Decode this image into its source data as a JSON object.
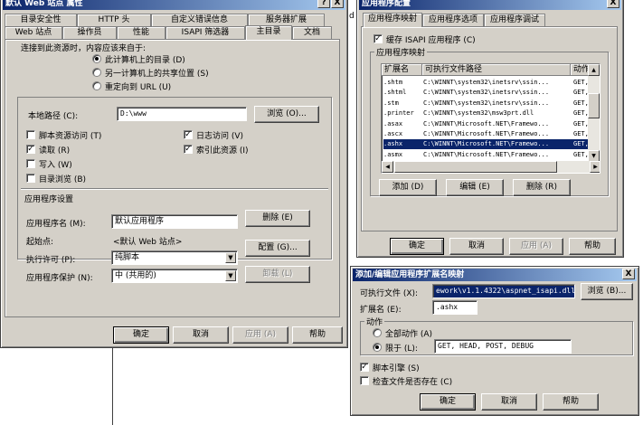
{
  "win1": {
    "title": "默认 Web 站点 属性",
    "help_btn": "?",
    "close_btn": "X",
    "tabs_row1": [
      "目录安全性",
      "HTTP 头",
      "自定义错误信息",
      "服务器扩展"
    ],
    "tabs_row2": [
      "Web 站点",
      "操作员",
      "性能",
      "ISAPI 筛选器",
      "主目录",
      "文档"
    ],
    "connect_label": "连接到此资源时，内容应该来自于:",
    "radio_options": [
      "此计算机上的目录 (D)",
      "另一计算机上的共享位置 (S)",
      "重定向到 URL (U)"
    ],
    "local_path_label": "本地路径 (C):",
    "local_path_value": "D:\\www",
    "browse_button": "浏览 (O)...",
    "checks_left": [
      {
        "label": "脚本资源访问 (T)",
        "checked": false
      },
      {
        "label": "读取 (R)",
        "checked": true
      },
      {
        "label": "写入 (W)",
        "checked": false
      },
      {
        "label": "目录浏览 (B)",
        "checked": false
      }
    ],
    "checks_right": [
      {
        "label": "日志访问 (V)",
        "checked": true
      },
      {
        "label": "索引此资源 (I)",
        "checked": true
      }
    ],
    "app_settings_label": "应用程序设置",
    "app_name_label": "应用程序名 (M):",
    "app_name_value": "默认应用程序",
    "remove_button": "删除 (E)",
    "start_point_label": "起始点:",
    "start_point_value": "<默认 Web 站点>",
    "config_button": "配置 (G)...",
    "exec_perm_label": "执行许可 (P):",
    "exec_perm_value": "纯脚本",
    "app_protect_label": "应用程序保护 (N):",
    "app_protect_value": "中 (共用的)",
    "unload_button": "卸载 (L)",
    "ok": "确定",
    "cancel": "取消",
    "apply": "应用 (A)",
    "help": "帮助",
    "stray_char": "d"
  },
  "win2": {
    "title": "应用程序配置",
    "close_btn": "X",
    "tabs": [
      "应用程序映射",
      "应用程序选项",
      "应用程序调试"
    ],
    "cache_label": "缓存 ISAPI 应用程序 (C)",
    "cache_checked": true,
    "mappings_label": "应用程序映射",
    "col_ext": "扩展名",
    "col_path": "可执行文件路径",
    "col_verb": "动作",
    "rows": [
      {
        "ext": ".shtm",
        "path": "C:\\WINNT\\system32\\inetsrv\\ssin...",
        "verb": "GET,"
      },
      {
        "ext": ".shtml",
        "path": "C:\\WINNT\\system32\\inetsrv\\ssin...",
        "verb": "GET,"
      },
      {
        "ext": ".stm",
        "path": "C:\\WINNT\\system32\\inetsrv\\ssin...",
        "verb": "GET,"
      },
      {
        "ext": ".printer",
        "path": "C:\\WINNT\\system32\\msw3prt.dll",
        "verb": "GET,"
      },
      {
        "ext": ".asax",
        "path": "C:\\WINNT\\Microsoft.NET\\Framewo...",
        "verb": "GET,"
      },
      {
        "ext": ".ascx",
        "path": "C:\\WINNT\\Microsoft.NET\\Framewo...",
        "verb": "GET,"
      },
      {
        "ext": ".ashx",
        "path": "C:\\WINNT\\Microsoft.NET\\Framewo...",
        "verb": "GET,"
      },
      {
        "ext": ".asmx",
        "path": "C:\\WINNT\\Microsoft.NET\\Framewo...",
        "verb": "GET,"
      }
    ],
    "selected_row": 6,
    "add_button": "添加 (D)",
    "edit_button": "编辑 (E)",
    "delete_button": "删除 (R)",
    "ok": "确定",
    "cancel": "取消",
    "apply": "应用 (A)",
    "help": "帮助"
  },
  "win3": {
    "title": "添加/编辑应用程序扩展名映射",
    "close_btn": "X",
    "exe_label": "可执行文件 (X):",
    "exe_value": "ework\\v1.1.4322\\aspnet_isapi.dll",
    "browse_button": "浏览 (B)...",
    "ext_label": "扩展名 (E):",
    "ext_value": ".ashx",
    "verbs_label": "动作",
    "radio_all": "全部动作 (A)",
    "radio_limit": "限于 (L):",
    "limit_value": "GET, HEAD, POST, DEBUG",
    "script_engine_label": "脚本引擎 (S)",
    "script_engine_checked": true,
    "check_file_label": "检查文件是否存在 (C)",
    "check_file_checked": false,
    "ok": "确定",
    "cancel": "取消",
    "help": "帮助"
  }
}
